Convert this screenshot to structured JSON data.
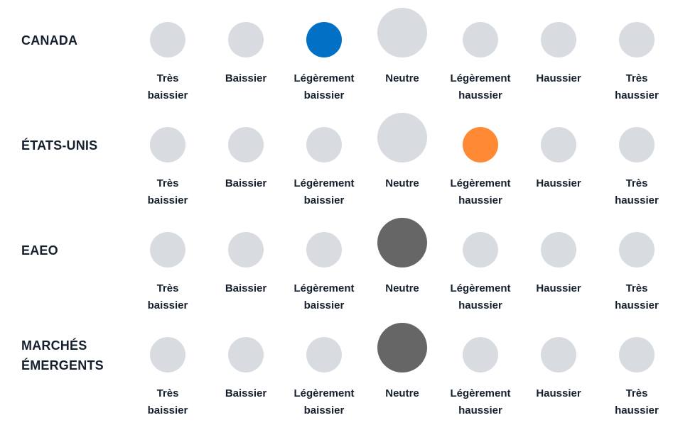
{
  "scale_options": [
    "Très baissier",
    "Baissier",
    "Légèrement baissier",
    "Neutre",
    "Légèrement haussier",
    "Haussier",
    "Très haussier"
  ],
  "scale_option_lines": [
    [
      "Très",
      "baissier"
    ],
    [
      "Baissier",
      ""
    ],
    [
      "Légèrement",
      "baissier"
    ],
    [
      "Neutre",
      ""
    ],
    [
      "Légèrement",
      "haussier"
    ],
    [
      "Haussier",
      ""
    ],
    [
      "Très",
      "haussier"
    ]
  ],
  "emphasized_option_index": 3,
  "colors": {
    "inactive": "#d8dbe0",
    "canada": "#0071c5",
    "etats_unis": "#ff8a33",
    "eaeo": "#666666",
    "marches_emergents": "#666666"
  },
  "regions": [
    {
      "name_lines": [
        "CANADA"
      ],
      "selected_index": 2,
      "selected_label": "Légèrement baissier",
      "color": "#0071c5"
    },
    {
      "name_lines": [
        "ÉTATS-UNIS"
      ],
      "selected_index": 4,
      "selected_label": "Légèrement haussier",
      "color": "#ff8a33"
    },
    {
      "name_lines": [
        "EAEO"
      ],
      "selected_index": 3,
      "selected_label": "Neutre",
      "color": "#666666"
    },
    {
      "name_lines": [
        "MARCHÉS",
        "ÉMERGENTS"
      ],
      "selected_index": 3,
      "selected_label": "Neutre",
      "color": "#666666"
    }
  ]
}
